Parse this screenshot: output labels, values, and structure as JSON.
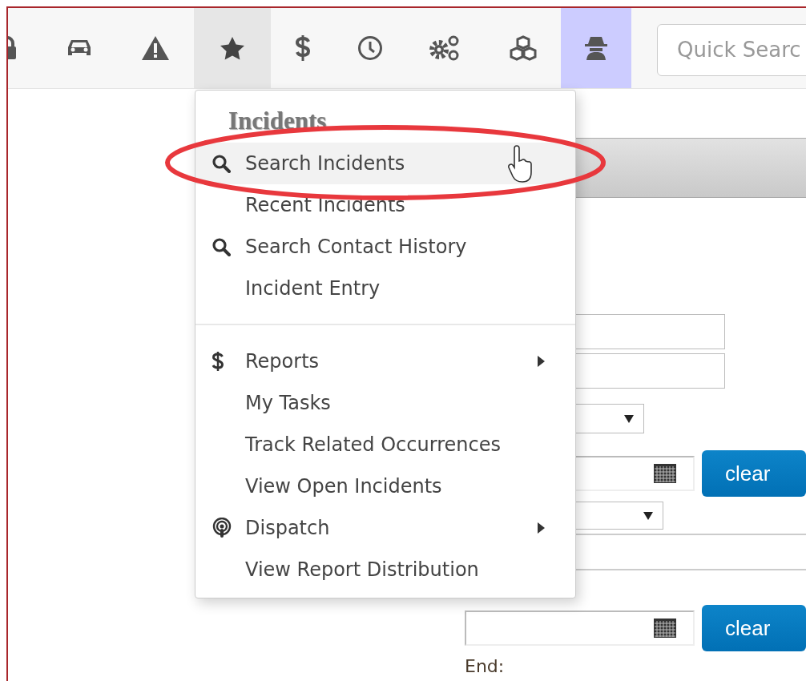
{
  "toolbar": {
    "buttons": [
      {
        "kind": "lock",
        "selected": false,
        "highlighted": false
      },
      {
        "kind": "car",
        "selected": false,
        "highlighted": false
      },
      {
        "kind": "warning",
        "selected": false,
        "highlighted": false
      },
      {
        "kind": "star",
        "selected": true,
        "highlighted": false
      },
      {
        "kind": "dollar",
        "selected": false,
        "highlighted": false
      },
      {
        "kind": "clock",
        "selected": false,
        "highlighted": false
      },
      {
        "kind": "gears",
        "selected": false,
        "highlighted": false
      },
      {
        "kind": "cubes",
        "selected": false,
        "highlighted": false
      },
      {
        "kind": "spy",
        "selected": false,
        "highlighted": true
      }
    ],
    "search": {
      "placeholder": "Quick Searc"
    }
  },
  "menu": {
    "title": "Incidents",
    "sections": [
      [
        {
          "label": "Search Incidents",
          "kind": "search",
          "submenu": false,
          "hovered": true,
          "circled": true
        },
        {
          "label": "Recent Incidents",
          "kind": "plain",
          "submenu": false,
          "hovered": false,
          "circled": false
        },
        {
          "label": "Search Contact History",
          "kind": "search",
          "submenu": false,
          "hovered": false,
          "circled": false
        },
        {
          "label": "Incident Entry",
          "kind": "plain",
          "submenu": false,
          "hovered": false,
          "circled": false
        }
      ],
      [
        {
          "label": "Reports",
          "kind": "dollar",
          "submenu": true,
          "hovered": false,
          "circled": false
        },
        {
          "label": "My Tasks",
          "kind": "plain",
          "submenu": false,
          "hovered": false,
          "circled": false
        },
        {
          "label": "Track Related Occurrences",
          "kind": "plain",
          "submenu": false,
          "hovered": false,
          "circled": false
        },
        {
          "label": "View Open Incidents",
          "kind": "plain",
          "submenu": false,
          "hovered": false,
          "circled": false
        },
        {
          "label": "Dispatch",
          "kind": "podcast",
          "submenu": true,
          "hovered": false,
          "circled": false
        },
        {
          "label": "View Report Distribution",
          "kind": "plain",
          "submenu": false,
          "hovered": false,
          "circled": false
        }
      ]
    ]
  },
  "form": {
    "rows": [
      {
        "kind": "bar"
      },
      {
        "kind": "text"
      },
      {
        "kind": "text"
      },
      {
        "kind": "select"
      },
      {
        "kind": "date",
        "button": "clear"
      },
      {
        "kind": "select"
      },
      {
        "kind": "rule"
      },
      {
        "kind": "rule"
      },
      {
        "kind": "date",
        "button": "clear"
      },
      {
        "kind": "label",
        "text": "End:"
      }
    ]
  }
}
